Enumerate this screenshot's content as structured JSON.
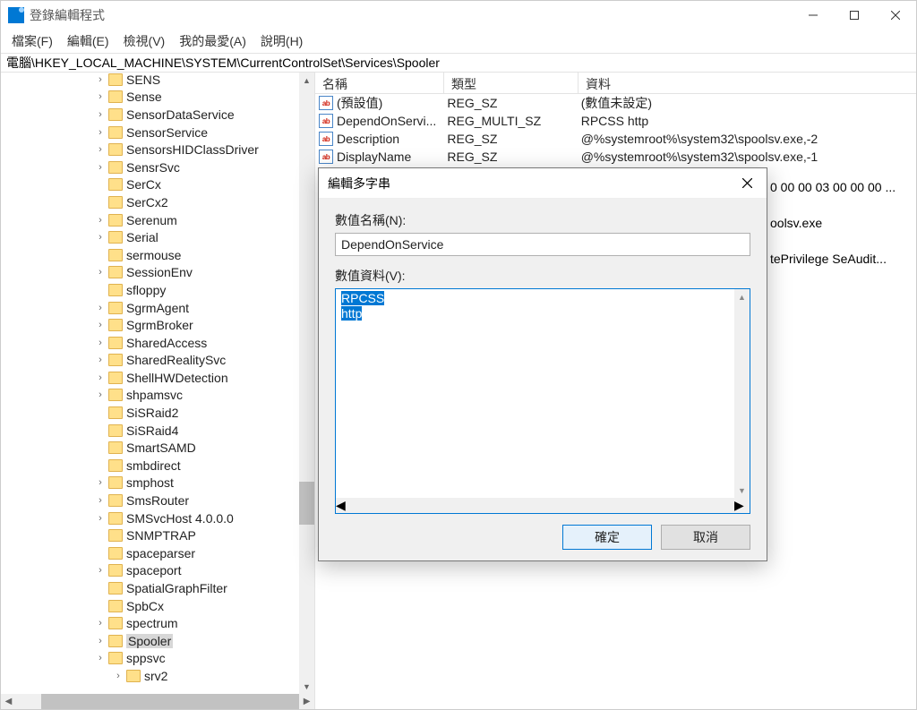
{
  "window": {
    "title": "登錄編輯程式"
  },
  "menu": {
    "file": "檔案(F)",
    "edit": "編輯(E)",
    "view": "檢視(V)",
    "favorites": "我的最愛(A)",
    "help": "說明(H)"
  },
  "address": "電腦\\HKEY_LOCAL_MACHINE\\SYSTEM\\CurrentControlSet\\Services\\Spooler",
  "tree": [
    {
      "label": "SENS",
      "expand": true
    },
    {
      "label": "Sense",
      "expand": true
    },
    {
      "label": "SensorDataService",
      "expand": true
    },
    {
      "label": "SensorService",
      "expand": true
    },
    {
      "label": "SensorsHIDClassDriver",
      "expand": true
    },
    {
      "label": "SensrSvc",
      "expand": true
    },
    {
      "label": "SerCx",
      "expand": false
    },
    {
      "label": "SerCx2",
      "expand": false
    },
    {
      "label": "Serenum",
      "expand": true
    },
    {
      "label": "Serial",
      "expand": true
    },
    {
      "label": "sermouse",
      "expand": false
    },
    {
      "label": "SessionEnv",
      "expand": true
    },
    {
      "label": "sfloppy",
      "expand": false
    },
    {
      "label": "SgrmAgent",
      "expand": true
    },
    {
      "label": "SgrmBroker",
      "expand": true
    },
    {
      "label": "SharedAccess",
      "expand": true
    },
    {
      "label": "SharedRealitySvc",
      "expand": true
    },
    {
      "label": "ShellHWDetection",
      "expand": true
    },
    {
      "label": "shpamsvc",
      "expand": true
    },
    {
      "label": "SiSRaid2",
      "expand": false
    },
    {
      "label": "SiSRaid4",
      "expand": false
    },
    {
      "label": "SmartSAMD",
      "expand": false
    },
    {
      "label": "smbdirect",
      "expand": false
    },
    {
      "label": "smphost",
      "expand": true
    },
    {
      "label": "SmsRouter",
      "expand": true
    },
    {
      "label": "SMSvcHost 4.0.0.0",
      "expand": true
    },
    {
      "label": "SNMPTRAP",
      "expand": false
    },
    {
      "label": "spaceparser",
      "expand": false
    },
    {
      "label": "spaceport",
      "expand": true
    },
    {
      "label": "SpatialGraphFilter",
      "expand": false
    },
    {
      "label": "SpbCx",
      "expand": false
    },
    {
      "label": "spectrum",
      "expand": true
    },
    {
      "label": "Spooler",
      "expand": true,
      "selected": true
    },
    {
      "label": "sppsvc",
      "expand": true
    },
    {
      "label": "srv2",
      "expand": true,
      "indent": true
    }
  ],
  "list": {
    "headers": {
      "name": "名稱",
      "type": "類型",
      "data": "資料"
    },
    "rows": [
      {
        "name": "(預設值)",
        "type": "REG_SZ",
        "data": "(數值未設定)"
      },
      {
        "name": "DependOnServi...",
        "type": "REG_MULTI_SZ",
        "data": "RPCSS http"
      },
      {
        "name": "Description",
        "type": "REG_SZ",
        "data": "@%systemroot%\\system32\\spoolsv.exe,-2"
      },
      {
        "name": "DisplayName",
        "type": "REG_SZ",
        "data": "@%systemroot%\\system32\\spoolsv.exe,-1"
      }
    ],
    "trunc_rows": [
      "0 00 00 03 00 00 00 ...",
      "",
      "oolsv.exe",
      "",
      "tePrivilege SeAudit..."
    ]
  },
  "dialog": {
    "title": "編輯多字串",
    "name_label": "數值名稱(N):",
    "name_value": "DependOnService",
    "data_label": "數值資料(V):",
    "data_lines": [
      "RPCSS",
      "http"
    ],
    "ok": "確定",
    "cancel": "取消"
  }
}
